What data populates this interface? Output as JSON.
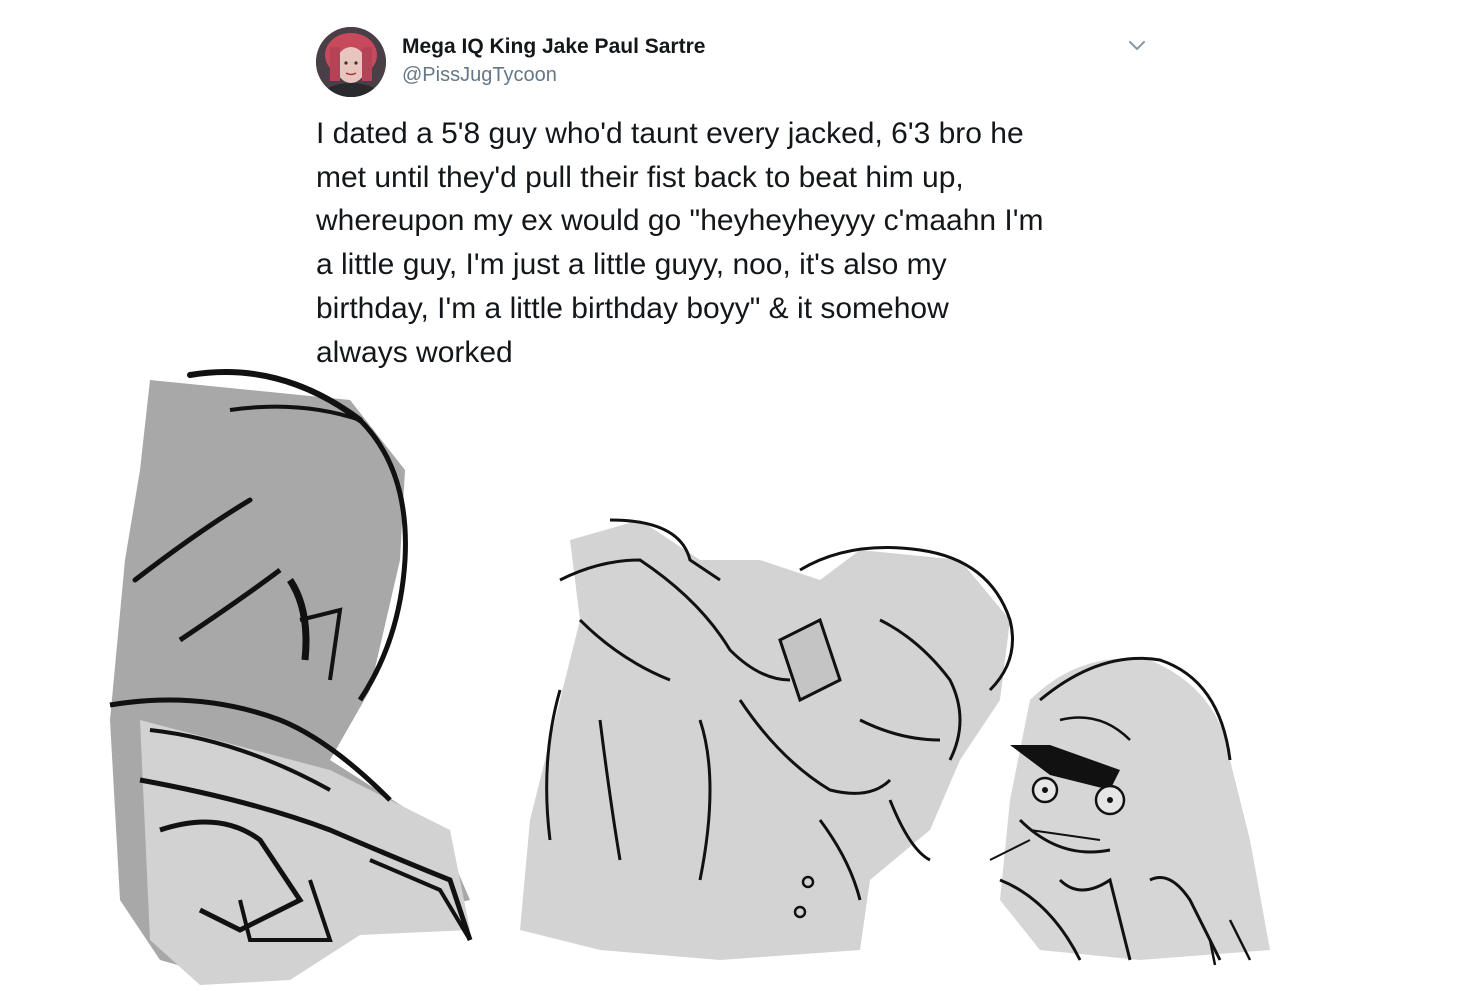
{
  "tweet": {
    "display_name": "Mega IQ King Jake Paul Sartre",
    "handle": "@PissJugTycoon",
    "text": "I dated a 5'8 guy who'd taunt every jacked, 6'3 bro he\nmet until they'd pull their fist back to beat him up,\nwhereupon my ex would go \"heyheyheyyy c'maahn I'm\na little guy, I'm just a little guyy, noo, it's also my\nbirthday, I'm a little birthday boyy\" & it somehow\nalways worked",
    "menu_icon": "chevron-down-icon",
    "avatar_icon": "profile-photo"
  },
  "illustration": {
    "description_icon": "sketch-illustration",
    "colors": {
      "fill_dark": "#a9a9a9",
      "fill_light": "#d4d4d4",
      "line": "#0d0d0d"
    }
  }
}
